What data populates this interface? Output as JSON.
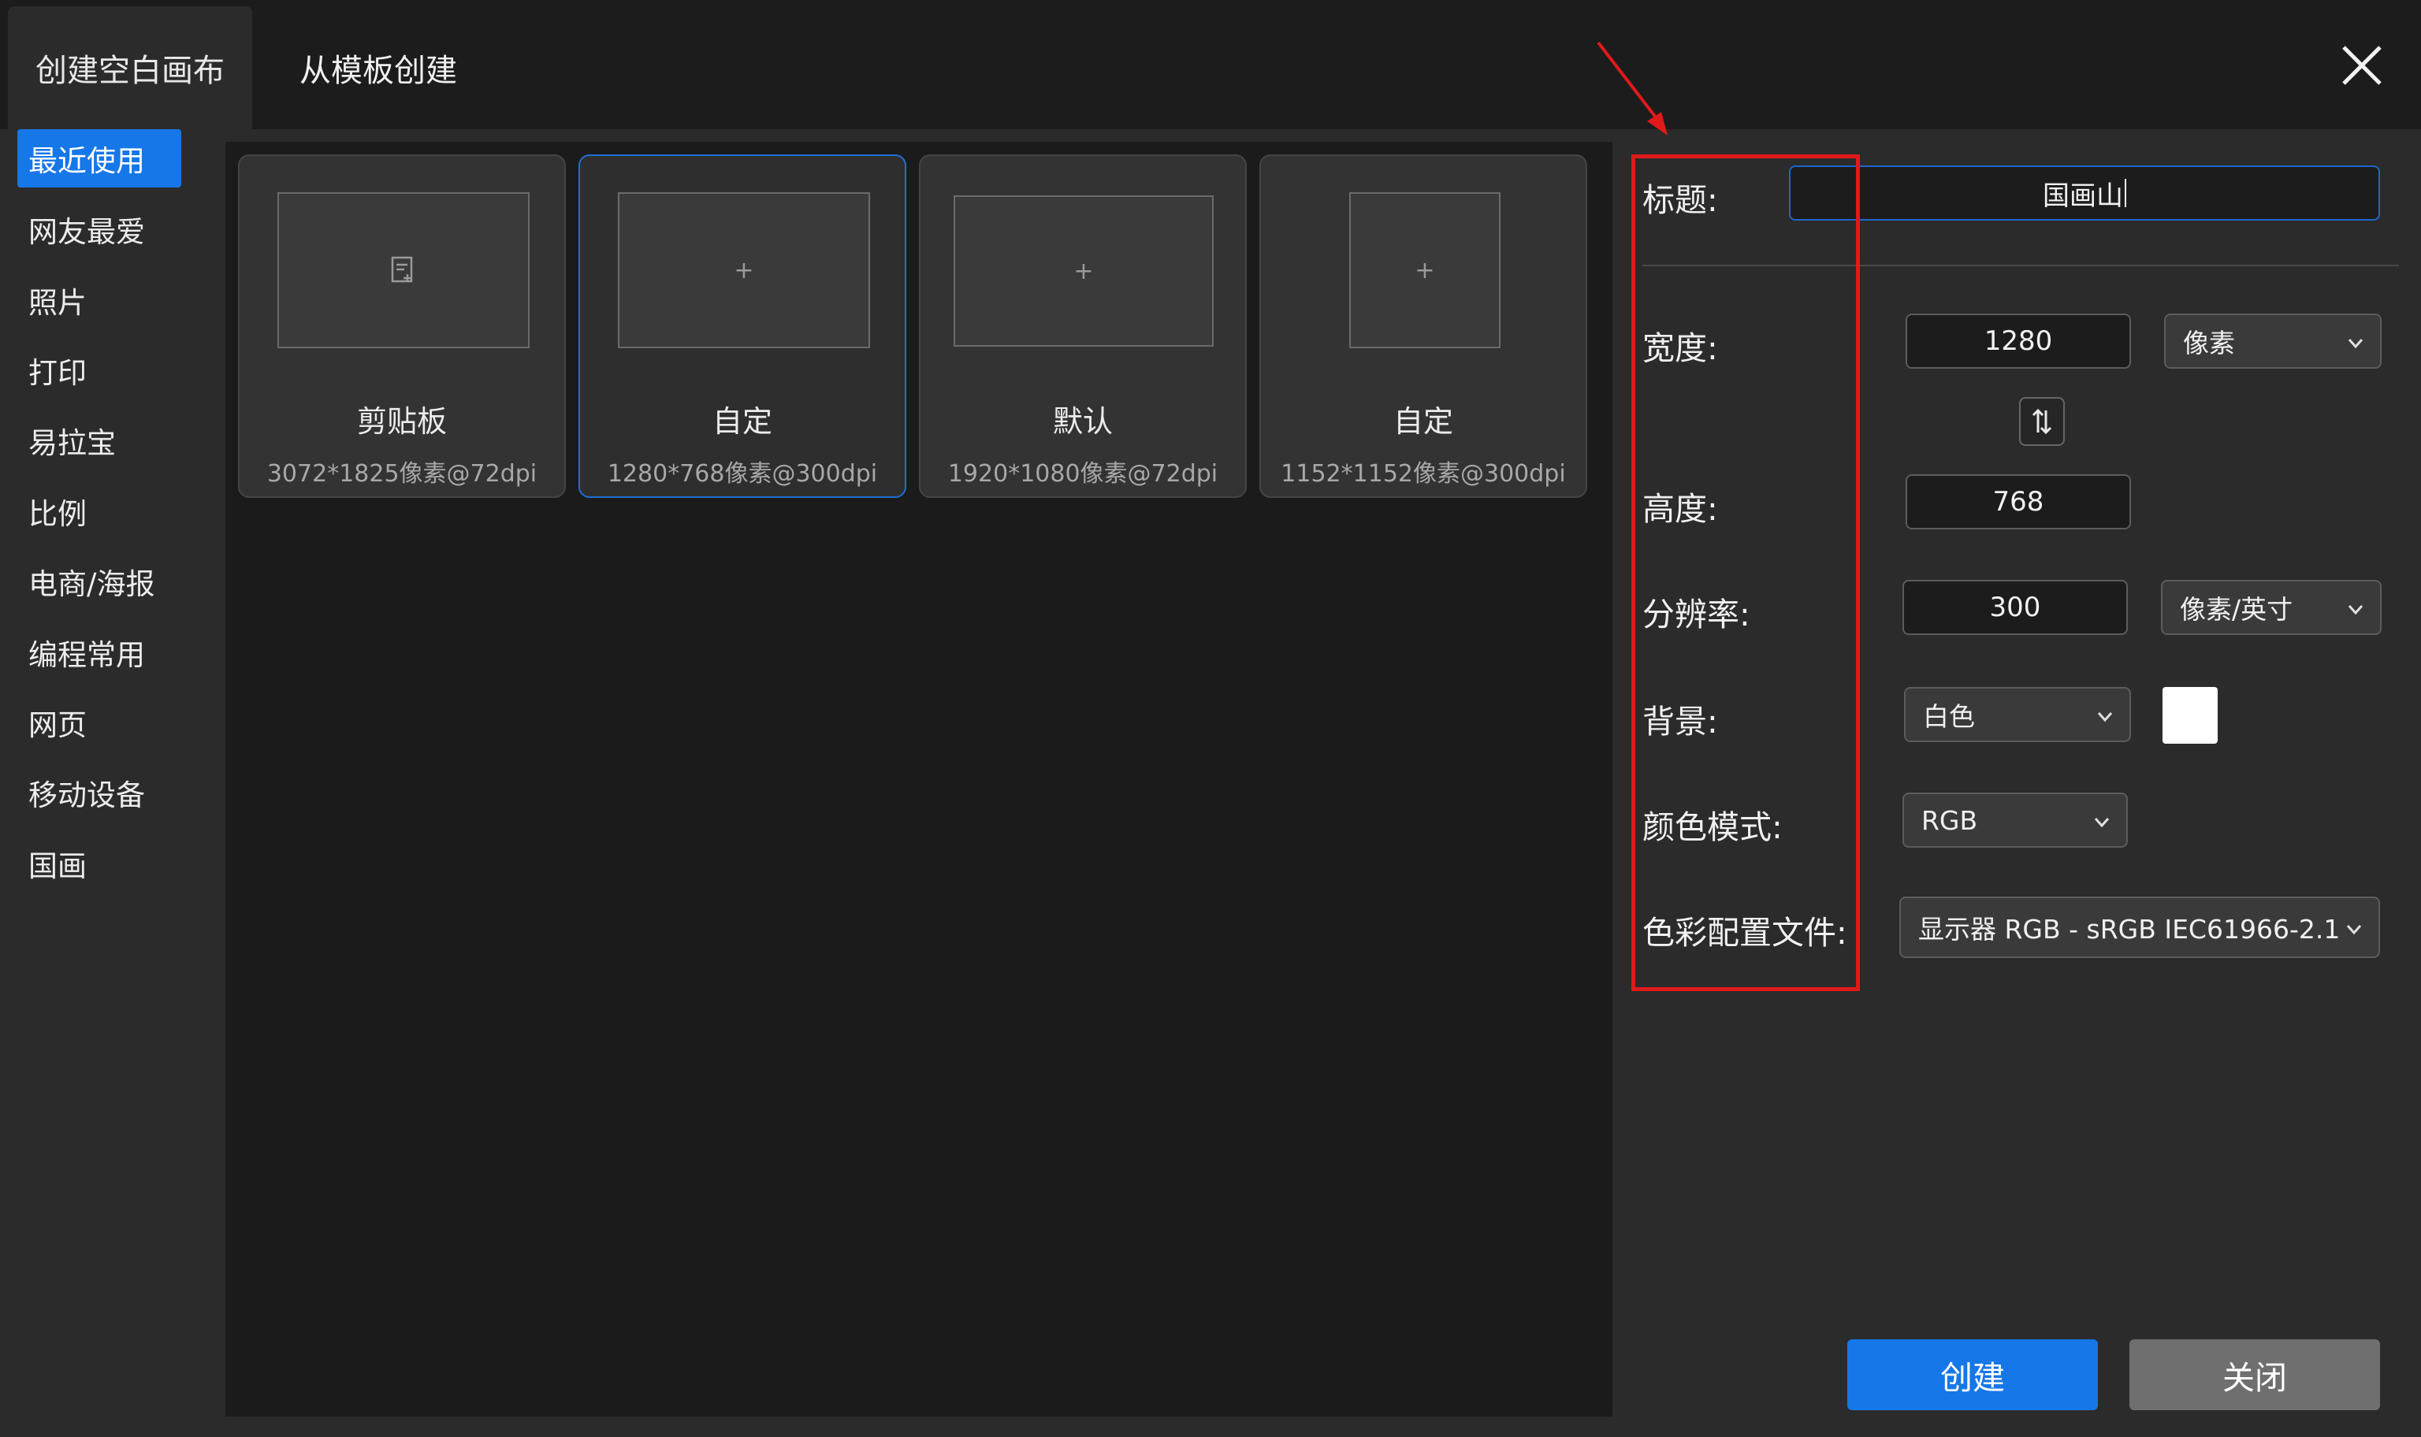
{
  "tabs": {
    "blank": "创建空白画布",
    "template": "从模板创建"
  },
  "sidebar": {
    "items": [
      {
        "label": "最近使用",
        "active": true
      },
      {
        "label": "网友最爱"
      },
      {
        "label": "照片"
      },
      {
        "label": "打印"
      },
      {
        "label": "易拉宝"
      },
      {
        "label": "比例"
      },
      {
        "label": "电商/海报"
      },
      {
        "label": "编程常用"
      },
      {
        "label": "网页"
      },
      {
        "label": "移动设备"
      },
      {
        "label": "国画"
      }
    ]
  },
  "cards": [
    {
      "title": "剪贴板",
      "sub": "3072*1825像素@72dpi",
      "icon": "clipboard-icon"
    },
    {
      "title": "自定",
      "sub": "1280*768像素@300dpi",
      "icon": "plus-icon",
      "selected": true
    },
    {
      "title": "默认",
      "sub": "1920*1080像素@72dpi",
      "icon": "plus-icon"
    },
    {
      "title": "自定",
      "sub": "1152*1152像素@300dpi",
      "icon": "plus-icon"
    }
  ],
  "form": {
    "title_label": "标题:",
    "title_value": "国画山",
    "width_label": "宽度:",
    "width_value": "1280",
    "width_unit": "像素",
    "height_label": "高度:",
    "height_value": "768",
    "resolution_label": "分辨率:",
    "resolution_value": "300",
    "resolution_unit": "像素/英寸",
    "background_label": "背景:",
    "background_value": "白色",
    "background_swatch": "#ffffff",
    "color_mode_label": "颜色模式:",
    "color_mode_value": "RGB",
    "profile_label": "色彩配置文件:",
    "profile_value": "显示器 RGB - sRGB IEC61966-2.1"
  },
  "buttons": {
    "create": "创建",
    "close": "关闭"
  },
  "colors": {
    "accent": "#1677e8",
    "annotation": "#e01a1a"
  }
}
